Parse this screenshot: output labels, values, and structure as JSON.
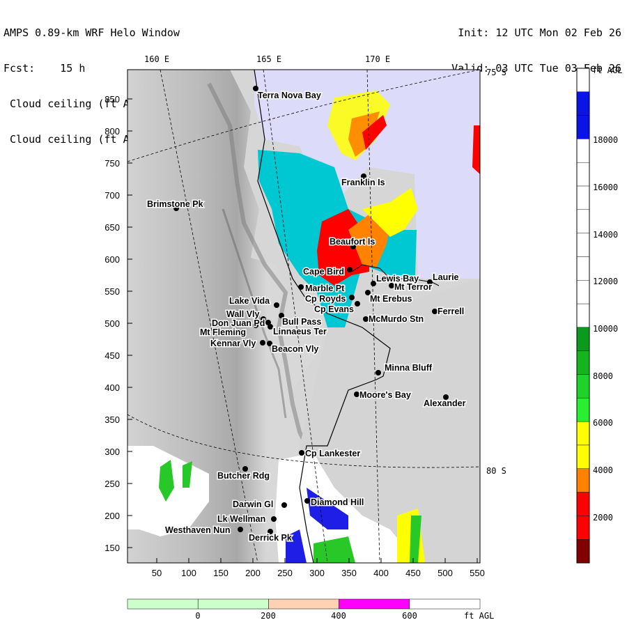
{
  "header": {
    "model": "AMPS 0.89-km WRF Helo Window",
    "forecast_label": "Fcst:",
    "forecast_value": "15 h",
    "field1": "Cloud ceiling (ft AGL)",
    "field2": "Cloud ceiling (ft AGL)",
    "init": "Init: 12 UTC Mon 02 Feb 26",
    "valid": "Valid: 03 UTC Tue 03 Feb 26"
  },
  "axes": {
    "x_ticks": [
      "50",
      "100",
      "150",
      "200",
      "250",
      "300",
      "350",
      "400",
      "450",
      "500",
      "550"
    ],
    "y_ticks": [
      "850",
      "800",
      "750",
      "700",
      "650",
      "600",
      "550",
      "500",
      "450",
      "400",
      "350",
      "300",
      "250",
      "200",
      "150"
    ],
    "lon_labels": [
      "160 E",
      "165 E",
      "170 E"
    ],
    "lat_labels": [
      "75 S",
      "80 S"
    ]
  },
  "places": [
    {
      "name": "Terra Nova Bay"
    },
    {
      "name": "Franklin Is"
    },
    {
      "name": "Brimstone Pk"
    },
    {
      "name": "Beaufort Is"
    },
    {
      "name": "Cape Bird"
    },
    {
      "name": "Lewis Bay"
    },
    {
      "name": "Laurie"
    },
    {
      "name": "Mt Terror"
    },
    {
      "name": "Marble Pt"
    },
    {
      "name": "Cp Royds"
    },
    {
      "name": "Mt Erebus"
    },
    {
      "name": "Lake Vida"
    },
    {
      "name": "Cp Evans"
    },
    {
      "name": "Ferrell"
    },
    {
      "name": "Wall Vly"
    },
    {
      "name": "McMurdo Stn"
    },
    {
      "name": "Bull Pass"
    },
    {
      "name": "Don Juan Pd"
    },
    {
      "name": "Mt Fleming"
    },
    {
      "name": "Linnaeus Ter"
    },
    {
      "name": "Kennar Vly"
    },
    {
      "name": "Beacon Vly"
    },
    {
      "name": "Minna Bluff"
    },
    {
      "name": "Moore's Bay"
    },
    {
      "name": "Alexander"
    },
    {
      "name": "Cp Lankester"
    },
    {
      "name": "Butcher Rdg"
    },
    {
      "name": "Darwin Gl"
    },
    {
      "name": "Diamond Hill"
    },
    {
      "name": "Lk Wellman"
    },
    {
      "name": "Westhaven Nun"
    },
    {
      "name": "Derrick Pk"
    }
  ],
  "colorbar": {
    "unit": "ft AGL",
    "labels": [
      "18000",
      "16000",
      "14000",
      "12000",
      "10000",
      "8000",
      "6000",
      "4000",
      "2000"
    ],
    "colors": [
      "#ffffff",
      "#0a14e6",
      "#0a14e6",
      "#ffffff",
      "#ffffff",
      "#ffffff",
      "#ffffff",
      "#ffffff",
      "#ffffff",
      "#ffffff",
      "#ffffff",
      "#0a9a1e",
      "#14b41e",
      "#1ed22a",
      "#28f030",
      "#ffff00",
      "#ffff00",
      "#ff8200",
      "#ff0000",
      "#ff0000",
      "#820000"
    ]
  },
  "terrain_bar": {
    "labels": [
      "0",
      "200",
      "400",
      "600"
    ],
    "unit": "ft AGL",
    "colors": [
      "#ccffcc",
      "#ccffcc",
      "#ffd2b4",
      "#ff00ff",
      "#ffffff"
    ]
  }
}
